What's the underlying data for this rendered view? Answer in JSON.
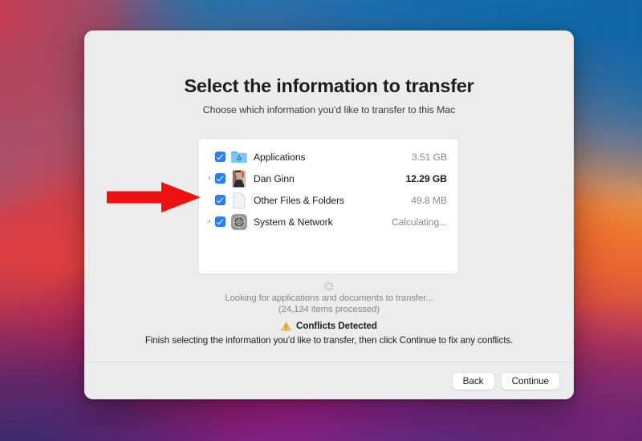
{
  "wallpaper": {
    "name": "macos-big-sur-gradient",
    "colors": {
      "top_left": "#d9394a",
      "top_right": "#0d6aa8",
      "right_mid": "#f08228",
      "bottom_left": "#2e2f6e",
      "bottom_right": "#8c1f7a",
      "center": "#e0204e"
    }
  },
  "dialog": {
    "name": "migration-assistant",
    "title": "Select the information to transfer",
    "subtitle": "Choose which information you'd like to transfer to this Mac",
    "list": {
      "rows": [
        {
          "label": "Applications",
          "size": "3.51 GB",
          "icon": "applications-folder-icon",
          "checked": true,
          "expandable": false,
          "size_emphasis": false
        },
        {
          "label": "Dan Ginn",
          "size": "12.29 GB",
          "icon": "user-avatar-icon",
          "checked": true,
          "expandable": true,
          "size_emphasis": true
        },
        {
          "label": "Other Files & Folders",
          "size": "49.8 MB",
          "icon": "document-icon",
          "checked": true,
          "expandable": false,
          "size_emphasis": false
        },
        {
          "label": "System & Network",
          "size": "Calculating...",
          "icon": "system-preferences-icon",
          "checked": true,
          "expandable": true,
          "size_emphasis": false
        }
      ]
    },
    "status": {
      "spinner": "loading-spinner",
      "line1": "Looking for applications and documents to transfer...",
      "line2": "(24,134 items processed)"
    },
    "conflicts": {
      "icon": "warning-triangle-icon",
      "icon_color": "#f2c04b",
      "label": "Conflicts Detected",
      "detail": "Finish selecting the information you'd like to transfer, then click Continue to fix any conflicts."
    },
    "footer": {
      "back_label": "Back",
      "continue_label": "Continue"
    }
  },
  "annotation": {
    "name": "red-pointer-arrow",
    "color": "#ee1111",
    "direction": "right",
    "points_at": "Other Files & Folders"
  }
}
